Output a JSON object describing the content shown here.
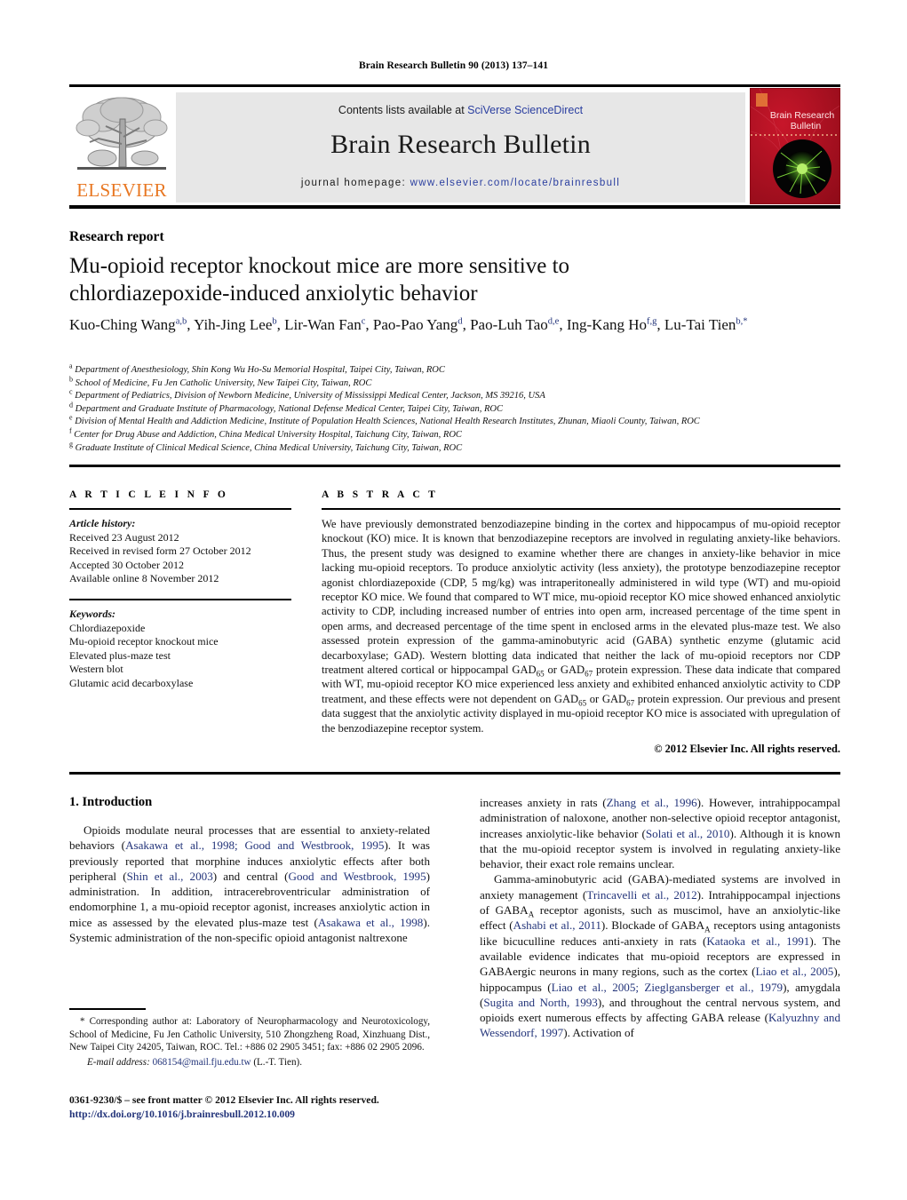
{
  "running_head": "Brain Research Bulletin 90 (2013) 137–141",
  "masthead": {
    "contents_prefix": "Contents lists available at ",
    "contents_link": "SciVerse ScienceDirect",
    "journal_title": "Brain Research Bulletin",
    "homepage_prefix": "journal homepage: ",
    "homepage_url": "www.elsevier.com/locate/brainresbull",
    "publisher": "ELSEVIER",
    "cover_title_line1": "Brain Research",
    "cover_title_line2": "Bulletin",
    "accent_orange": "#E87722",
    "link_blue": "#2b3fa0",
    "panel_gray": "#e7e7e7",
    "cover_red": "#b01020"
  },
  "article": {
    "type": "Research report",
    "title_line1": "Mu-opioid receptor knockout mice are more sensitive to",
    "title_line2": "chlordiazepoxide-induced anxiolytic behavior",
    "authors": [
      {
        "name": "Kuo-Ching Wang",
        "marks": "a,b",
        "sep": ", "
      },
      {
        "name": "Yih-Jing Lee",
        "marks": "b",
        "sep": ", "
      },
      {
        "name": "Lir-Wan Fan",
        "marks": "c",
        "sep": ", "
      },
      {
        "name": "Pao-Pao Yang",
        "marks": "d",
        "sep": ", "
      },
      {
        "name": "Pao-Luh Tao",
        "marks": "d,e",
        "sep": ", "
      },
      {
        "name": "Ing-Kang Ho",
        "marks": "f,g",
        "sep": ", "
      },
      {
        "name": "Lu-Tai Tien",
        "marks": "b,*",
        "sep": ""
      }
    ],
    "affiliations": [
      {
        "mark": "a",
        "text": "Department of Anesthesiology, Shin Kong Wu Ho-Su Memorial Hospital, Taipei City, Taiwan, ROC"
      },
      {
        "mark": "b",
        "text": "School of Medicine, Fu Jen Catholic University, New Taipei City, Taiwan, ROC"
      },
      {
        "mark": "c",
        "text": "Department of Pediatrics, Division of Newborn Medicine, University of Mississippi Medical Center, Jackson, MS 39216, USA"
      },
      {
        "mark": "d",
        "text": "Department and Graduate Institute of Pharmacology, National Defense Medical Center, Taipei City, Taiwan, ROC"
      },
      {
        "mark": "e",
        "text": "Division of Mental Health and Addiction Medicine, Institute of Population Health Sciences, National Health Research Institutes, Zhunan, Miaoli County, Taiwan, ROC"
      },
      {
        "mark": "f",
        "text": "Center for Drug Abuse and Addiction, China Medical University Hospital, Taichung City, Taiwan, ROC"
      },
      {
        "mark": "g",
        "text": "Graduate Institute of Clinical Medical Science, China Medical University, Taichung City, Taiwan, ROC"
      }
    ]
  },
  "article_info": {
    "heading": "A R T I C L E   I N F O",
    "history_label": "Article history:",
    "history": [
      "Received 23 August 2012",
      "Received in revised form 27 October 2012",
      "Accepted 30 October 2012",
      "Available online 8 November 2012"
    ],
    "keywords_label": "Keywords:",
    "keywords": [
      "Chlordiazepoxide",
      "Mu-opioid receptor knockout mice",
      "Elevated plus-maze test",
      "Western blot",
      "Glutamic acid decarboxylase"
    ]
  },
  "abstract": {
    "heading": "A B S T R A C T",
    "part1": "We have previously demonstrated benzodiazepine binding in the cortex and hippocampus of mu-opioid receptor knockout (KO) mice. It is known that benzodiazepine receptors are involved in regulating anxiety-like behaviors. Thus, the present study was designed to examine whether there are changes in anxiety-like behavior in mice lacking mu-opioid receptors. To produce anxiolytic activity (less anxiety), the prototype benzodiazepine receptor agonist chlordiazepoxide (CDP, 5 mg/kg) was intraperitoneally administered in wild type (WT) and mu-opioid receptor KO mice. We found that compared to WT mice, mu-opioid receptor KO mice showed enhanced anxiolytic activity to CDP, including increased number of entries into open arm, increased percentage of the time spent in open arms, and decreased percentage of the time spent in enclosed arms in the elevated plus-maze test. We also assessed protein expression of the gamma-aminobutyric acid (GABA) synthetic enzyme (glutamic acid decarboxylase; GAD). Western blotting data indicated that neither the lack of mu-opioid receptors nor CDP treatment altered cortical or hippocampal GAD",
    "sub1": "65",
    "part2": " or GAD",
    "sub2": "67",
    "part3": " protein expression. These data indicate that compared with WT, mu-opioid receptor KO mice experienced less anxiety and exhibited enhanced anxiolytic activity to CDP treatment, and these effects were not dependent on GAD",
    "sub3": "65",
    "part4": " or GAD",
    "sub4": "67",
    "part5": " protein expression. Our previous and present data suggest that the anxiolytic activity displayed in mu-opioid receptor KO mice is associated with upregulation of the benzodiazepine receptor system.",
    "copyright": "© 2012 Elsevier Inc. All rights reserved."
  },
  "introduction": {
    "heading": "1.  Introduction",
    "left_para1_a": "Opioids modulate neural processes that are essential to anxiety-related behaviors (",
    "left_ref1": "Asakawa et al., 1998; Good and Westbrook, 1995",
    "left_para1_b": "). It was previously reported that morphine induces anxiolytic effects after both peripheral (",
    "left_ref2": "Shin et al., 2003",
    "left_para1_c": ") and central (",
    "left_ref3": "Good and Westbrook, 1995",
    "left_para1_d": ") administration. In addition, intracerebroventricular administration of endomorphine 1, a mu-opioid receptor agonist, increases anxiolytic action in mice as assessed by the elevated plus-maze test (",
    "left_ref4": "Asakawa et al., 1998",
    "left_para1_e": "). Systemic administration of the non-specific opioid antagonist naltrexone",
    "right_para1_a": "increases anxiety in rats (",
    "right_ref1": "Zhang et al., 1996",
    "right_para1_b": "). However, intrahippocampal administration of naloxone, another non-selective opioid receptor antagonist, increases anxiolytic-like behavior (",
    "right_ref2": "Solati et al., 2010",
    "right_para1_c": "). Although it is known that the mu-opioid receptor system is involved in regulating anxiety-like behavior, their exact role remains unclear.",
    "right_para2_a": "Gamma-aminobutyric acid (GABA)-mediated systems are involved in anxiety management (",
    "right_ref3": "Trincavelli et al., 2012",
    "right_para2_b": "). Intrahippocampal injections of GABA",
    "right_sub1": "A",
    "right_para2_c": " receptor agonists, such as muscimol, have an anxiolytic-like effect (",
    "right_ref4": "Ashabi et al., 2011",
    "right_para2_d": "). Blockade of GABA",
    "right_sub2": "A",
    "right_para2_e": " receptors using antagonists like bicuculline reduces anti-anxiety in rats (",
    "right_ref5": "Kataoka et al., 1991",
    "right_para2_f": "). The available evidence indicates that mu-opioid receptors are expressed in GABAergic neurons in many regions, such as the cortex (",
    "right_ref6": "Liao et al., 2005",
    "right_para2_g": "), hippocampus (",
    "right_ref7": "Liao et al., 2005; Zieglgansberger et al., 1979",
    "right_para2_h": "), amygdala (",
    "right_ref8": "Sugita and North, 1993",
    "right_para2_i": "), and throughout the central nervous system, and opioids exert numerous effects by affecting GABA release (",
    "right_ref9": "Kalyuzhny and Wessendorf, 1997",
    "right_para2_j": "). Activation of"
  },
  "footnote": {
    "corresponding": "* Corresponding author at: Laboratory of Neuropharmacology and Neurotoxicology, School of Medicine, Fu Jen Catholic University, 510 Zhongzheng Road, Xinzhuang Dist., New Taipei City 24205, Taiwan, ROC. Tel.: +886 02 2905 3451; fax: +886 02 2905 2096.",
    "email_label": "E-mail address:",
    "email": "068154@mail.fju.edu.tw",
    "email_suffix": " (L.-T. Tien).",
    "imprint": "0361-9230/$ – see front matter © 2012 Elsevier Inc. All rights reserved.",
    "doi": "http://dx.doi.org/10.1016/j.brainresbull.2012.10.009"
  }
}
